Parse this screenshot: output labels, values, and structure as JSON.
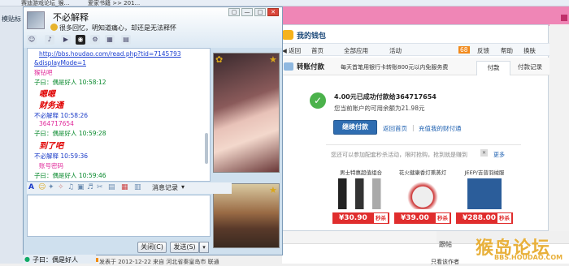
{
  "browser": {
    "tabs": [
      "",
      "赛迪游戏论坛_猴…",
      "爱家书籍 >> 201..."
    ],
    "left_label": "模贴标",
    "bottom_text": "发表于 2012-12-22  来自 河北省秦皇岛市 联通",
    "right_labels": [
      "跟帖",
      "只看该作者"
    ]
  },
  "watermark": {
    "logo": "猴岛论坛",
    "url": "BBS.HOUDAO.COM"
  },
  "qq": {
    "name": "不必解释",
    "signature": "很多回忆，明知道痛心，却还是无法释怀",
    "window_controls": [
      "▢",
      "—",
      "□",
      "✕"
    ],
    "toolbar_icons": [
      "people-icon",
      "mic-icon",
      "video-icon",
      "photo-icon",
      "share-icon",
      "app-icon",
      "more-icon"
    ],
    "messages": [
      {
        "text": "http://bbs.houdao.com/read.php?tid=7145793",
        "style": "link"
      },
      {
        "text": "&displayMode=1",
        "style": "link"
      },
      {
        "text": "猴钻吧",
        "style": "pink"
      },
      {
        "text": "子曰：偶是好人   10:58:12",
        "style": "green"
      },
      {
        "text": "嗯嗯",
        "style": "red"
      },
      {
        "text": "财务通",
        "style": "red"
      },
      {
        "text": "不必解释     10:58:26",
        "style": "blue"
      },
      {
        "text": "364717654",
        "style": "pink"
      },
      {
        "text": "子曰：偶是好人   10:59:28",
        "style": "green"
      },
      {
        "text": "到了吧",
        "style": "red"
      },
      {
        "text": "不必解释     10:59:36",
        "style": "blue"
      },
      {
        "text": "账号密码",
        "style": "pink"
      },
      {
        "text": "子曰：偶是好人   10:59:46",
        "style": "green"
      }
    ],
    "format_bar": {
      "history": "消息记录"
    },
    "close_btn": "关闭(C)",
    "send_btn": "发送(S)",
    "send_arrow": "▾"
  },
  "bottom_status": {
    "name": "子曰：偶是好人"
  },
  "wallet": {
    "title": "我的钱包",
    "nav": [
      "◀ 返回",
      "首页",
      "全部应用",
      "活动",
      "68",
      "反馈",
      "帮助",
      "换肤"
    ],
    "banner_title": "转账付款",
    "banner_ad": "每天首笔用银行卡转账800元以内免服务费",
    "tabs": {
      "pay": "付款",
      "records": "付款记录"
    },
    "success_line1": "4.00元已成功付款给364717654",
    "success_line2": "您当前账户的可用余额为21.98元",
    "continue_btn": "继续付款",
    "link_home": "返回首页",
    "link_sep": "|",
    "link_records": "充值我的财付通",
    "promo_text": "您还可以参加配套秒杀活动，限时抢购，抢到就是赚到",
    "promo_more": "更多",
    "products": [
      {
        "title": "男士特惠超值组合",
        "price": "¥30.90",
        "tag": "秒杀",
        "color": "#2a2a2a"
      },
      {
        "title": "花火健康香灯熏蒸灯",
        "price": "¥39.00",
        "tag": "秒杀",
        "color": "#d7d7d7"
      },
      {
        "title": "JEEP/吉普羽绒服",
        "price": "¥288.00",
        "tag": "秒杀",
        "color": "#2b5d9a"
      }
    ]
  }
}
